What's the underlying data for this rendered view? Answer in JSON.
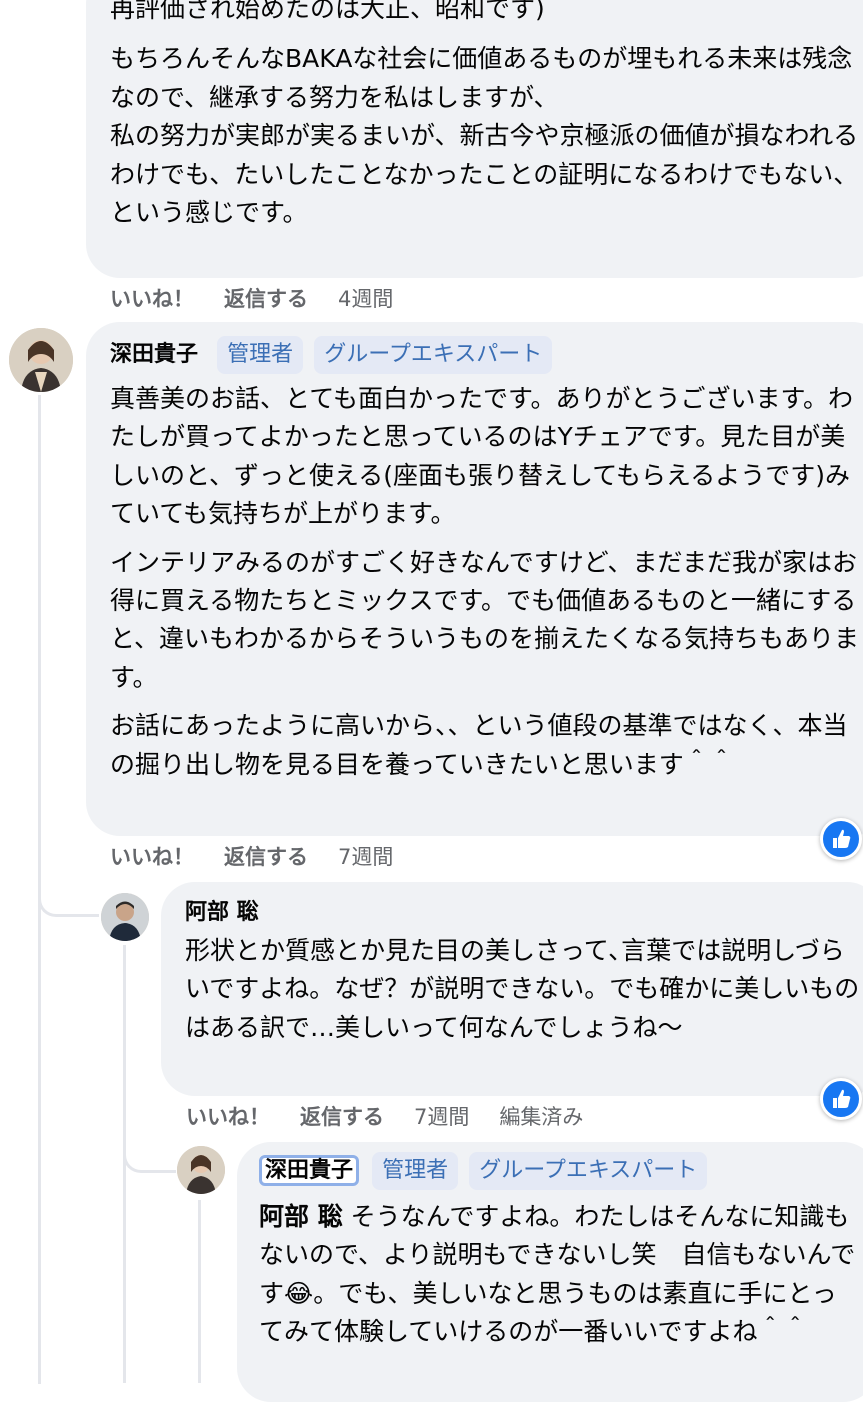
{
  "comment1": {
    "partial_top": "再評価され始めたのは大正、昭和です)",
    "paragraphs": [
      "もちろんそんなBAKAな社会に価値あるものが埋もれる未来は残念なので、継承する努力を私はしますが、",
      "私の努力が実郎が実るまいが、新古今や京極派の価値が損なわれるわけでも、たいしたことなかったことの証明になるわけでもない、",
      "という感じです。"
    ],
    "actions": {
      "like": "いいね！",
      "reply": "返信する",
      "time": "4週間"
    }
  },
  "comment2": {
    "author": "深田貴子",
    "badges": [
      "管理者",
      "グループエキスパート"
    ],
    "paragraphs": [
      "真善美のお話、とても面白かったです。ありがとうございます。わたしが買ってよかったと思っているのはYチェアです。見た目が美しいのと、ずっと使える(座面も張り替えしてもらえるようです)みていても気持ちが上がります。",
      "インテリアみるのがすごく好きなんですけど、まだまだ我が家はお得に買える物たちとミックスです。でも価値あるものと一緒にすると、違いもわかるからそういうものを揃えたくなる気持ちもあります。",
      "お話にあったように高いから、、という値段の基準ではなく、本当の掘り出し物を見る目を養っていきたいと思います＾＾"
    ],
    "actions": {
      "like": "いいね！",
      "reply": "返信する",
      "time": "7週間"
    }
  },
  "reply1": {
    "author": "阿部 聡",
    "text": "形状とか質感とか見た目の美しさって､言葉では説明しづらいですよね。なぜ？が説明できない。でも確かに美しいものはある訳で…美しいって何なんでしょうね〜",
    "actions": {
      "like": "いいね！",
      "reply": "返信する",
      "time": "7週間",
      "edited": "編集済み"
    }
  },
  "reply2": {
    "author": "深田貴子",
    "badges": [
      "管理者",
      "グループエキスパート"
    ],
    "mention": "阿部 聡",
    "text_a": " そうなんですよね。わたしはそんなに知識もないので、より説明もできないし笑　自信もないんです",
    "emoji": "😂",
    "text_b": "。でも、美しいなと思うものは素直に手にとってみて体験していけるのが一番いいですよね＾＾"
  },
  "colors": {
    "bubble": "#f0f2f5",
    "badge_text": "#3b6fb5",
    "badge_bg": "#e4e9f5",
    "like_blue": "#1877f2",
    "meta": "#65676b"
  },
  "icons": [
    "like-thumb-icon"
  ]
}
